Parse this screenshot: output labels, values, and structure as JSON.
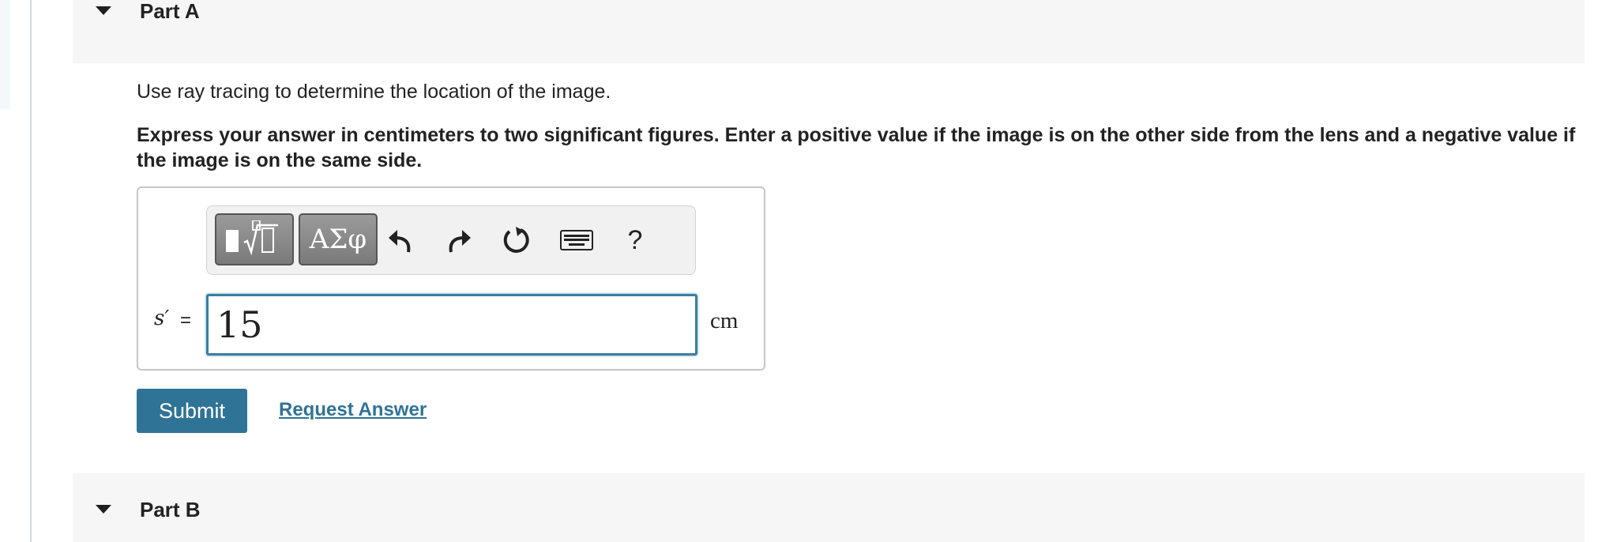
{
  "parts": [
    {
      "title": "Part A"
    },
    {
      "title": "Part B"
    }
  ],
  "question": {
    "instruction": "Use ray tracing to determine the location of the image.",
    "instruction_bold": "Express your answer in centimeters to two significant figures. Enter a positive value if the image is on the other side from the lens and a negative value if the image is on the same side."
  },
  "answer": {
    "variable_label": "s′",
    "equals": "=",
    "value": "15",
    "unit": "cm"
  },
  "toolbar": {
    "greek_label": "ΑΣφ",
    "help_label": "?",
    "icons": [
      "templates-icon",
      "greek-letters-icon",
      "undo-icon",
      "redo-icon",
      "reset-icon",
      "keyboard-icon",
      "help-icon"
    ]
  },
  "actions": {
    "submit_label": "Submit",
    "request_answer_label": "Request Answer"
  },
  "colors": {
    "accent": "#2f7396",
    "input_border": "#3c7fa0",
    "header_bg": "#f6f6f6"
  }
}
